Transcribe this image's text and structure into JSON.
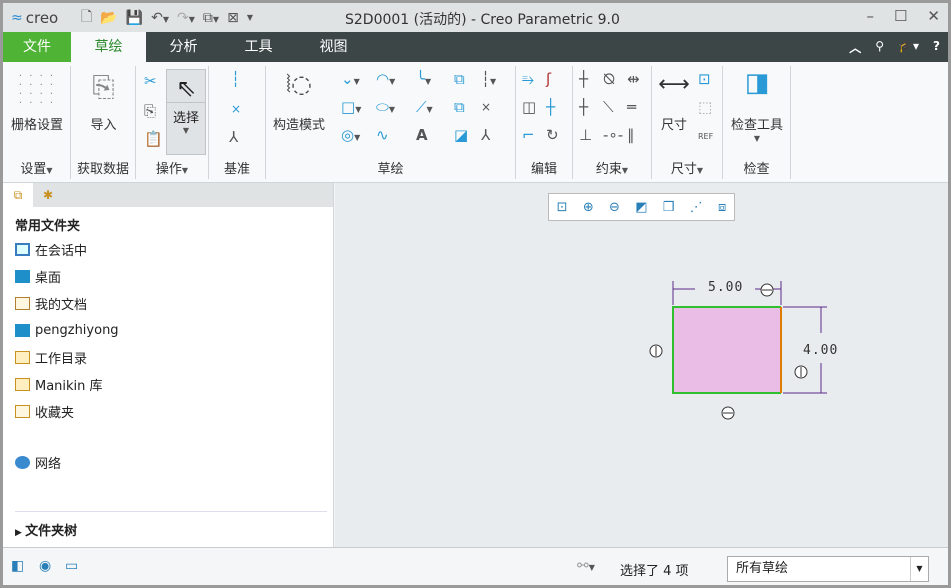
{
  "app": {
    "logo": "creo",
    "title": "S2D0001 (活动的) - Creo Parametric 9.0"
  },
  "tabs": [
    {
      "label": "文件"
    },
    {
      "label": "草绘"
    },
    {
      "label": "分析"
    },
    {
      "label": "工具"
    },
    {
      "label": "视图"
    }
  ],
  "ribbon": {
    "grid_settings": "栅格设置",
    "import": "导入",
    "select": "选择",
    "construction_mode": "构造模式",
    "dimension": "尺寸",
    "inspect_tools": "检查工具",
    "groups": {
      "settings": "设置",
      "get_data": "获取数据",
      "operations": "操作",
      "datum": "基准",
      "sketch": "草绘",
      "edit": "编辑",
      "constrain": "约束",
      "dimension": "尺寸",
      "inspect": "检查"
    }
  },
  "left": {
    "heading": "常用文件夹",
    "items": [
      {
        "label": "在会话中"
      },
      {
        "label": "桌面"
      },
      {
        "label": "我的文档"
      },
      {
        "label": "pengzhiyong"
      },
      {
        "label": "工作目录"
      },
      {
        "label": "Manikin 库"
      },
      {
        "label": "收藏夹"
      },
      {
        "label": "网络"
      }
    ],
    "folder_tree": "文件夹树"
  },
  "sketch": {
    "width_dim": "5.00",
    "height_dim": "4.00",
    "fill": "#e9bde6",
    "edge": "#2fbf2f",
    "selected_edge": "#e07a00"
  },
  "status": {
    "selection": "选择了 4 项",
    "filter": "所有草绘"
  }
}
